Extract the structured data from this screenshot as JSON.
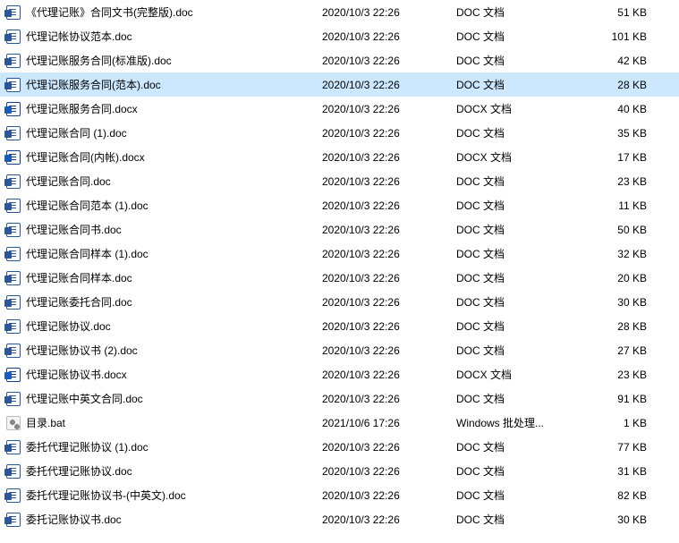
{
  "selectedIndex": 3,
  "iconNames": {
    "doc": "word-doc-icon",
    "docx": "word-docx-icon",
    "bat": "batch-file-icon"
  },
  "files": [
    {
      "name": "《代理记账》合同文书(完整版).doc",
      "date": "2020/10/3 22:26",
      "type": "DOC 文档",
      "size": "51 KB",
      "icon": "doc"
    },
    {
      "name": "代理记帐协议范本.doc",
      "date": "2020/10/3 22:26",
      "type": "DOC 文档",
      "size": "101 KB",
      "icon": "doc"
    },
    {
      "name": "代理记账服务合同(标准版).doc",
      "date": "2020/10/3 22:26",
      "type": "DOC 文档",
      "size": "42 KB",
      "icon": "doc"
    },
    {
      "name": "代理记账服务合同(范本).doc",
      "date": "2020/10/3 22:26",
      "type": "DOC 文档",
      "size": "28 KB",
      "icon": "doc"
    },
    {
      "name": "代理记账服务合同.docx",
      "date": "2020/10/3 22:26",
      "type": "DOCX 文档",
      "size": "40 KB",
      "icon": "docx"
    },
    {
      "name": "代理记账合同 (1).doc",
      "date": "2020/10/3 22:26",
      "type": "DOC 文档",
      "size": "35 KB",
      "icon": "doc"
    },
    {
      "name": "代理记账合同(内帐).docx",
      "date": "2020/10/3 22:26",
      "type": "DOCX 文档",
      "size": "17 KB",
      "icon": "docx"
    },
    {
      "name": "代理记账合同.doc",
      "date": "2020/10/3 22:26",
      "type": "DOC 文档",
      "size": "23 KB",
      "icon": "doc"
    },
    {
      "name": "代理记账合同范本 (1).doc",
      "date": "2020/10/3 22:26",
      "type": "DOC 文档",
      "size": "11 KB",
      "icon": "doc"
    },
    {
      "name": "代理记账合同书.doc",
      "date": "2020/10/3 22:26",
      "type": "DOC 文档",
      "size": "50 KB",
      "icon": "doc"
    },
    {
      "name": "代理记账合同样本 (1).doc",
      "date": "2020/10/3 22:26",
      "type": "DOC 文档",
      "size": "32 KB",
      "icon": "doc"
    },
    {
      "name": "代理记账合同样本.doc",
      "date": "2020/10/3 22:26",
      "type": "DOC 文档",
      "size": "20 KB",
      "icon": "doc"
    },
    {
      "name": "代理记账委托合同.doc",
      "date": "2020/10/3 22:26",
      "type": "DOC 文档",
      "size": "30 KB",
      "icon": "doc"
    },
    {
      "name": "代理记账协议.doc",
      "date": "2020/10/3 22:26",
      "type": "DOC 文档",
      "size": "28 KB",
      "icon": "doc"
    },
    {
      "name": "代理记账协议书 (2).doc",
      "date": "2020/10/3 22:26",
      "type": "DOC 文档",
      "size": "27 KB",
      "icon": "doc"
    },
    {
      "name": "代理记账协议书.docx",
      "date": "2020/10/3 22:26",
      "type": "DOCX 文档",
      "size": "23 KB",
      "icon": "docx"
    },
    {
      "name": "代理记账中英文合同.doc",
      "date": "2020/10/3 22:26",
      "type": "DOC 文档",
      "size": "91 KB",
      "icon": "doc"
    },
    {
      "name": "目录.bat",
      "date": "2021/10/6 17:26",
      "type": "Windows 批处理...",
      "size": "1 KB",
      "icon": "bat"
    },
    {
      "name": "委托代理记账协议 (1).doc",
      "date": "2020/10/3 22:26",
      "type": "DOC 文档",
      "size": "77 KB",
      "icon": "doc"
    },
    {
      "name": "委托代理记账协议.doc",
      "date": "2020/10/3 22:26",
      "type": "DOC 文档",
      "size": "31 KB",
      "icon": "doc"
    },
    {
      "name": "委托代理记账协议书-(中英文).doc",
      "date": "2020/10/3 22:26",
      "type": "DOC 文档",
      "size": "82 KB",
      "icon": "doc"
    },
    {
      "name": "委托记账协议书.doc",
      "date": "2020/10/3 22:26",
      "type": "DOC 文档",
      "size": "30 KB",
      "icon": "doc"
    }
  ]
}
